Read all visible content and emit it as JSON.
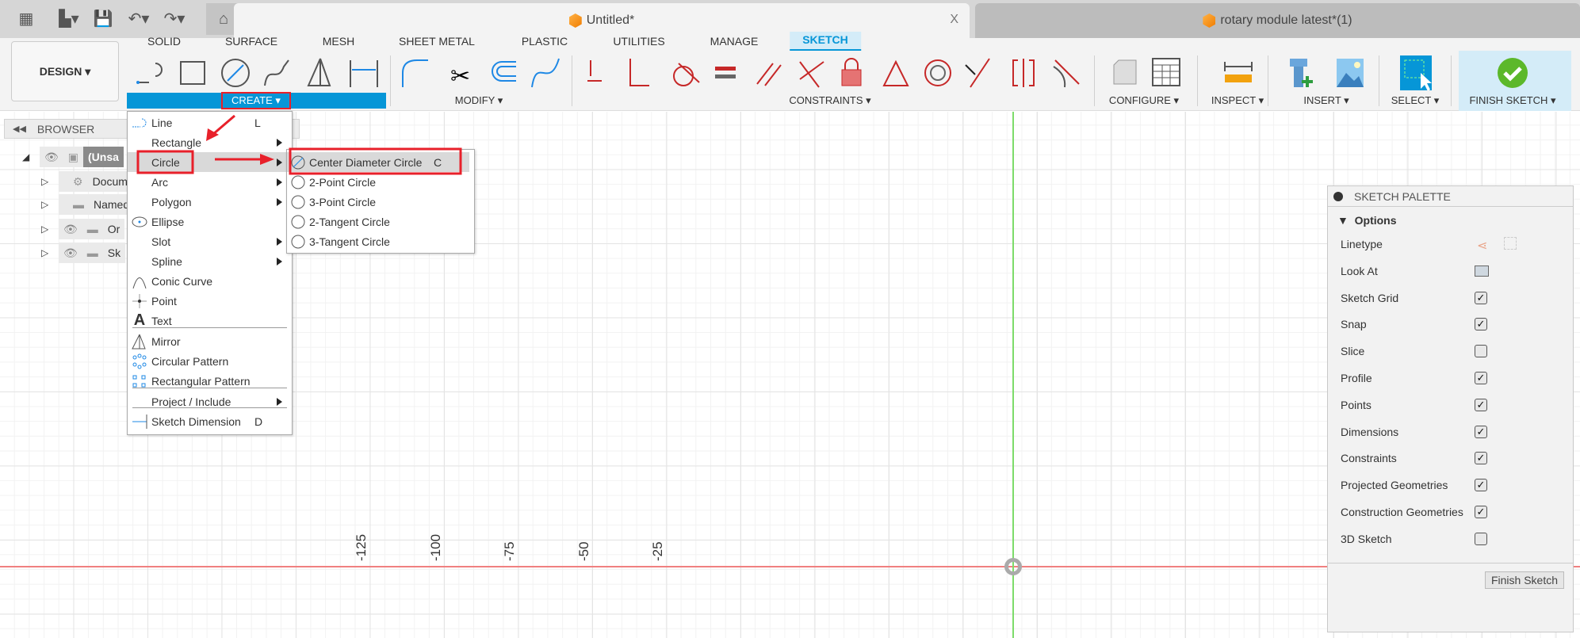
{
  "quick_access": {
    "icons": [
      "apps-grid-icon",
      "file-icon",
      "save-icon",
      "undo-icon",
      "redo-icon",
      "home-icon"
    ]
  },
  "doc_tabs": [
    {
      "label": "Untitled*",
      "close": "X",
      "active": true
    },
    {
      "label": "rotary module latest*(1)",
      "active": false
    }
  ],
  "workspace": {
    "label": "DESIGN ▾"
  },
  "ribbon_tabs": [
    "SOLID",
    "SURFACE",
    "MESH",
    "SHEET METAL",
    "PLASTIC",
    "UTILITIES",
    "MANAGE",
    "SKETCH"
  ],
  "active_tab": "SKETCH",
  "groups": [
    "CREATE ▾",
    "MODIFY ▾",
    "CONSTRAINTS ▾",
    "CONFIGURE ▾",
    "INSPECT ▾",
    "INSERT ▾",
    "SELECT ▾",
    "FINISH SKETCH ▾"
  ],
  "tools": [
    "line",
    "rectangle",
    "circle",
    "spline",
    "mirror",
    "dimension",
    "fillet",
    "trim",
    "offset",
    "spline-curve",
    "fix",
    "coincident",
    "tangent",
    "equal",
    "parallel",
    "perpendicular",
    "lock",
    "midpoint",
    "concentric",
    "collinear",
    "symmetry",
    "curvature",
    "configure-cube",
    "table",
    "measure",
    "insert-bolt",
    "insert-image",
    "select",
    "finish-check"
  ],
  "browser": {
    "title": "BROWSER",
    "items": [
      "(Unsa",
      "Docume",
      "Named",
      "Or",
      "Sk"
    ]
  },
  "create_menu": {
    "items": [
      {
        "label": "Line",
        "shortcut": "L",
        "icon": "line-icon"
      },
      {
        "label": "Rectangle",
        "submenu": true
      },
      {
        "label": "Circle",
        "submenu": true,
        "highlighted": true
      },
      {
        "label": "Arc",
        "submenu": true
      },
      {
        "label": "Polygon",
        "submenu": true
      },
      {
        "label": "Ellipse",
        "icon": "ellipse-icon"
      },
      {
        "label": "Slot",
        "submenu": true
      },
      {
        "label": "Spline",
        "submenu": true
      },
      {
        "label": "Conic Curve",
        "icon": "conic-icon"
      },
      {
        "label": "Point",
        "icon": "point-icon"
      },
      {
        "label": "Text",
        "icon": "text-icon"
      },
      {
        "label": "Mirror",
        "icon": "mirror-icon"
      },
      {
        "label": "Circular Pattern",
        "icon": "circular-pattern-icon"
      },
      {
        "label": "Rectangular Pattern",
        "icon": "rectangular-pattern-icon"
      },
      {
        "label": "Project / Include",
        "submenu": true
      },
      {
        "label": "Sketch Dimension",
        "shortcut": "D",
        "icon": "dimension-icon"
      }
    ]
  },
  "circle_submenu": {
    "items": [
      {
        "label": "Center Diameter Circle",
        "shortcut": "C",
        "highlighted": true
      },
      {
        "label": "2-Point Circle"
      },
      {
        "label": "3-Point Circle"
      },
      {
        "label": "2-Tangent Circle"
      },
      {
        "label": "3-Tangent Circle"
      }
    ]
  },
  "axis_labels": [
    "-125",
    "-100",
    "-75",
    "-50",
    "-25"
  ],
  "palette": {
    "title": "SKETCH PALETTE",
    "section": "Options",
    "rows": [
      {
        "label": "Linetype",
        "type": "icons"
      },
      {
        "label": "Look At",
        "type": "icon"
      },
      {
        "label": "Sketch Grid",
        "checked": true
      },
      {
        "label": "Snap",
        "checked": true
      },
      {
        "label": "Slice",
        "checked": false
      },
      {
        "label": "Profile",
        "checked": true
      },
      {
        "label": "Points",
        "checked": true
      },
      {
        "label": "Dimensions",
        "checked": true
      },
      {
        "label": "Constraints",
        "checked": true
      },
      {
        "label": "Projected Geometries",
        "checked": true
      },
      {
        "label": "Construction Geometries",
        "checked": true
      },
      {
        "label": "3D Sketch",
        "checked": false
      }
    ],
    "finish_button": "Finish Sketch"
  },
  "colors": {
    "accent": "#0696d7",
    "annotation": "#e8202a",
    "x_axis": "#f08080",
    "y_axis": "#7ddc6a",
    "finish": "#5cb82a"
  }
}
